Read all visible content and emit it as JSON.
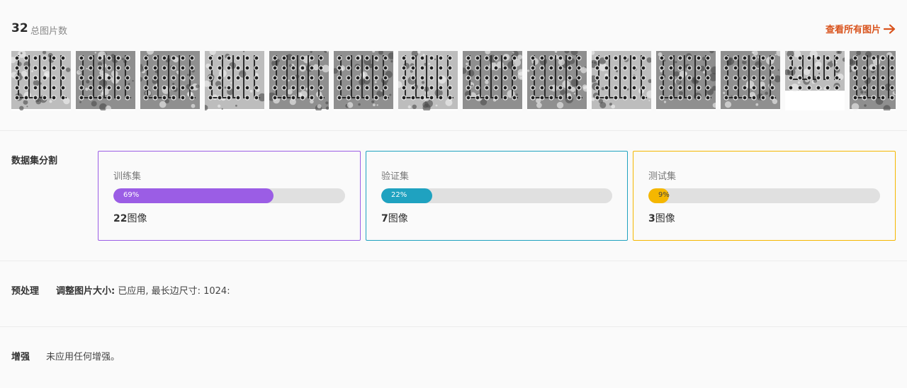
{
  "header": {
    "count": "32",
    "count_label": "总图片数",
    "view_all_label": "查看所有图片",
    "view_all_icon": "arrow-right-icon",
    "accent_color": "#d9541e"
  },
  "thumbnails": {
    "count": 14,
    "icon": "pcb-image-thumbnail"
  },
  "dataset_split": {
    "title": "数据集分割",
    "splits": [
      {
        "name": "训练集",
        "percent_label": "69%",
        "percent": 69,
        "count": "22",
        "unit": "图像",
        "color": "#9b5de5"
      },
      {
        "name": "验证集",
        "percent_label": "22%",
        "percent": 22,
        "count": "7",
        "unit": "图像",
        "color": "#1fa2c0"
      },
      {
        "name": "测试集",
        "percent_label": "9%",
        "percent": 9,
        "count": "3",
        "unit": "图像",
        "color": "#f5b700"
      }
    ]
  },
  "preprocessing": {
    "title": "预处理",
    "item_label": "调整图片大小:",
    "item_value": "已应用, 最长边尺寸: 1024:"
  },
  "augmentation": {
    "title": "增强",
    "text": "未应用任何增强。"
  }
}
